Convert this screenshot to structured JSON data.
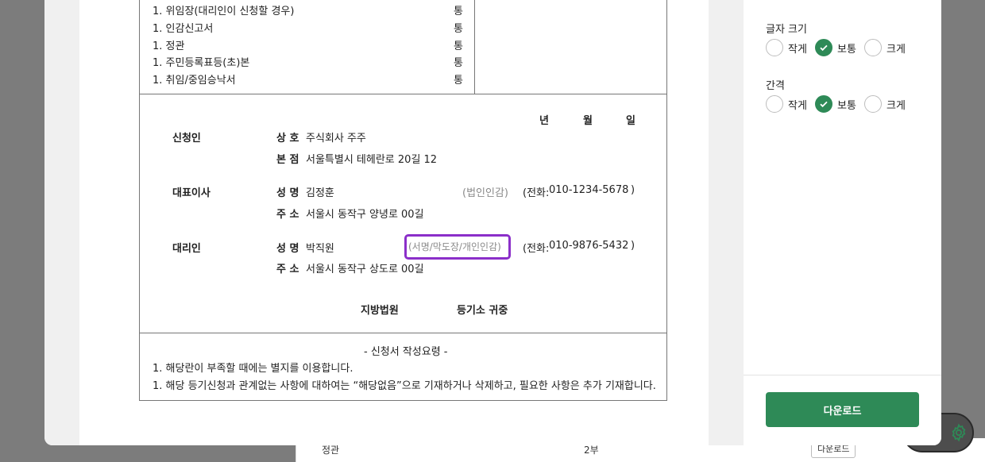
{
  "background": {
    "row_label": "정관",
    "row_count": "2부",
    "row_button": "다운로드"
  },
  "document": {
    "attachments": [
      {
        "label": "1. 위임장(대리인이 신청할 경우)",
        "unit": "통"
      },
      {
        "label": "1. 인감신고서",
        "unit": "통"
      },
      {
        "label": "1. 정관",
        "unit": "통"
      },
      {
        "label": "1. 주민등록표등(초)본",
        "unit": "통"
      },
      {
        "label": "1. 취임/중임승낙서",
        "unit": "통"
      }
    ],
    "date": {
      "year": "년",
      "month": "월",
      "day": "일"
    },
    "applicant": {
      "title": "신청인",
      "name_label": "상 호",
      "name": "주식회사 주주",
      "hq_label": "본 점",
      "hq": "서울특별시 테헤란로 20길 12"
    },
    "ceo": {
      "title": "대표이사",
      "name_label": "성 명",
      "name": "김정훈",
      "seal": "(법인인감)",
      "phone_prefix": "(전화:",
      "phone": "010-1234-5678",
      "phone_suffix": ")",
      "addr_label": "주 소",
      "addr": "서울시 동작구 양녕로 00길"
    },
    "agent": {
      "title": "대리인",
      "name_label": "성 명",
      "name": "박직원",
      "seal": "(서명/막도장/개인인감)",
      "phone_prefix": "(전화:",
      "phone": "010-9876-5432",
      "phone_suffix": ")",
      "addr_label": "주 소",
      "addr": "서울시 동작구 상도로 00길"
    },
    "court": "지방법원",
    "registry": "등기소 귀중",
    "guide_title": "- 신청서 작성요령 -",
    "guide_items": [
      "1. 해당란이 부족할 때에는 별지를 이용합니다.",
      "1. 해당 등기신청과 관계없는 사항에 대하여는 “해당없음”으로 기재하거나 삭제하고, 필요한 사항은 추가 기재합니다."
    ]
  },
  "panel": {
    "font_size": {
      "title": "글자 크기",
      "options": [
        "작게",
        "보통",
        "크게"
      ],
      "selected": "보통"
    },
    "spacing": {
      "title": "간격",
      "options": [
        "작게",
        "보통",
        "크게"
      ],
      "selected": "보통"
    },
    "download_label": "다운로드"
  },
  "colors": {
    "accent": "#2e8a57",
    "highlight": "#8b2fc9"
  },
  "icons": {
    "settings": "gear-icon",
    "check": "check-icon"
  }
}
